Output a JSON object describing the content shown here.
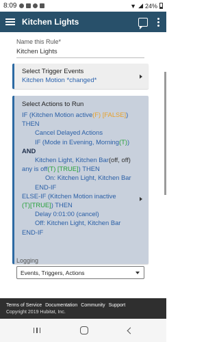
{
  "status_bar": {
    "time": "8:09",
    "battery": "24%"
  },
  "app_bar": {
    "title": "Kitchen Lights"
  },
  "rule_name": {
    "label": "Name this Rule*",
    "value": "Kitchen Lights"
  },
  "trigger": {
    "title": "Select Trigger Events",
    "value": "Kitchen Motion *changed*"
  },
  "actions": {
    "title": "Select Actions to Run",
    "lines": {
      "l1a": "IF (Kitchen Motion active",
      "l1b": "(F) [FALSE]",
      "l1c": ")",
      "l2": "THEN",
      "l3": "Cancel Delayed Actions",
      "l4a": "IF (Mode in Evening, Morning",
      "l4b": "(T)",
      "l4c": ")",
      "l5": "AND",
      "l6a": "Kitchen Light, Kitchen Bar",
      "l6b": "(off, off)",
      "l7a": "any is off",
      "l7b": "(T) [TRUE]",
      "l7c": ") THEN",
      "l8": "On: Kitchen Light, Kitchen Bar",
      "l9": "END-IF",
      "l10": "ELSE-IF (Kitchen Motion inactive",
      "l10b": "(T)",
      "l11a": "[TRUE]",
      "l11b": ") THEN",
      "l12": "Delay 0:01:00 (cancel)",
      "l13": "Off: Kitchen Light, Kitchen Bar",
      "l14": "END-IF"
    }
  },
  "logging": {
    "label": "Logging",
    "selected": "Events, Triggers, Actions"
  },
  "footer": {
    "links": [
      "Terms of Service",
      "Documentation",
      "Community",
      "Support"
    ],
    "copyright": "Copyright 2019 Hubitat, Inc."
  },
  "colors": {
    "app_bar": "#28506a",
    "accent_blue": "#2a62ad",
    "false_orange": "#e8a028",
    "true_green": "#27a13b",
    "actions_bg": "#c8d0dc",
    "footer_bg": "#2f2f2f"
  }
}
